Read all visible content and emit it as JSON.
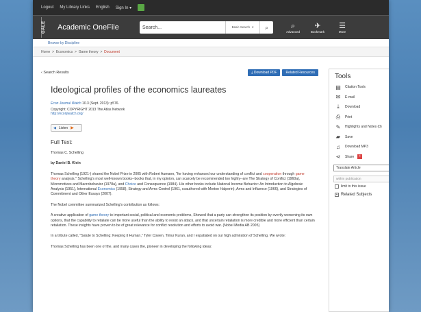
{
  "topbar": {
    "items": [
      "Logout",
      "My Library Links",
      "English",
      "Sign In ▾"
    ]
  },
  "header": {
    "brand": "GALE",
    "app_name": "Academic OneFile",
    "search_placeholder": "Search...",
    "search_type": "Basic Search",
    "icons": [
      {
        "label": "Advanced",
        "icon": "search-advanced-icon",
        "glyph": "⌕"
      },
      {
        "label": "Bookmark",
        "icon": "bookmark-icon",
        "glyph": "✈"
      },
      {
        "label": "More",
        "icon": "menu-icon",
        "glyph": "☰"
      }
    ]
  },
  "discipline": "Browse by Discipline",
  "breadcrumb": {
    "home": "Home",
    "level1": "Economics",
    "level2": "Game theory",
    "current": "Document"
  },
  "actions": {
    "back": "Search Results",
    "download_pdf": "Download PDF",
    "related": "Related Resources"
  },
  "article": {
    "title": "Ideological profiles of the economics laureates",
    "source": "Econ Journal Watch",
    "citation": "10.3 (Sept. 2013): p576.",
    "copyright": "Copyright: COPYRIGHT 2013 The Atlas Network",
    "url": "http://econjwatch.org/",
    "listen": "Listen",
    "fulltext_heading": "Full Text:",
    "author1": "Thomas C. Schelling",
    "author2": "by Daniel B. Klein",
    "p1a": "Thomas Schelling (1921-) shared the Nobel Prize in 2005 with Robert Aumann, \"for having enhanced our understanding of conflict and ",
    "p1b": "cooperation",
    "p1c": " through ",
    "p1d": "game theory",
    "p1e": " analysis.\" Schelling's most well-known books--books that, in my opinion, can scarcely be recommended too highly--are The Strategy of Conflict (1960a), Micromotives and Macrobehavior (1978a), and ",
    "p1f": "Choice",
    "p1g": " and Consequence (1984). His other books include National Income Behavior: An Introduction to Algebraic Analysis (1951), International ",
    "p1h": "Economics",
    "p1i": " (1958), Strategy and Arms Control (1961, coauthored with Morton Halperin), Arms and Influence (1966), and Strategies of Commitment and Other Essays (2007).",
    "p2": "The Nobel committee summarized Schelling's contribution as follows:",
    "p3a": "A creative application of ",
    "p3b": "game theory",
    "p3c": " to important social, political and economic problems, Showed that a party can strengthen its position by overtly worsening its own options, that the capability to retaliate can be more useful than the ability to resist an attack, and that uncertain retaliation is more credible and more efficient than certain retaliation. These insights have proven to be of great relevance for conflict resolution and efforts to avoid war. (Nobel Media AB 2005)",
    "p4": "In a tribute called, \"Salute to Schelling: Keeping it Human,\" Tyler Cowen, Timur Kuran, and I expatiated on our high admiration of Schelling. We wrote:",
    "p5": "Thomas Schelling has been one of the, and many cases the, pioneer in developing the following ideas:"
  },
  "tools": {
    "heading": "Tools",
    "items": [
      {
        "label": "Citation Tools",
        "icon": "citation-icon",
        "glyph": "▤"
      },
      {
        "label": "E-mail",
        "icon": "email-icon",
        "glyph": "✉"
      },
      {
        "label": "Download",
        "icon": "download-icon",
        "glyph": "⤓"
      },
      {
        "label": "Print",
        "icon": "print-icon",
        "glyph": "⎙"
      },
      {
        "label": "Highlights and Notes (0)",
        "icon": "highlight-icon",
        "glyph": "✎"
      },
      {
        "label": "Save",
        "icon": "save-icon",
        "glyph": "▰"
      },
      {
        "label": "Download MP3",
        "icon": "music-icon",
        "glyph": "♫"
      },
      {
        "label": "Share",
        "icon": "share-icon",
        "glyph": "⋖"
      }
    ],
    "translate": "Translate Article",
    "within_placeholder": "within publication",
    "limit": "limit to this issue",
    "related_subjects": "Related Subjects"
  },
  "colors": {
    "accent": "#2f6db5",
    "header": "#3c3c3c",
    "topbar": "#2b2b2b"
  }
}
